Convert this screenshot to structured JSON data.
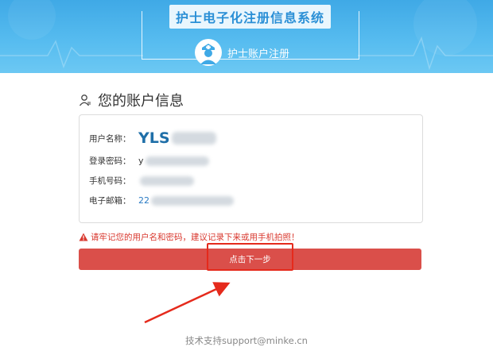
{
  "banner": {
    "title": "护士电子化注册信息系统",
    "subtitle": "护士账户注册"
  },
  "account": {
    "header": "您的账户信息",
    "username": {
      "label": "用户名称：",
      "value": "YLS"
    },
    "password": {
      "label": "登录密码：",
      "value": "y"
    },
    "phone": {
      "label": "手机号码：",
      "value": ""
    },
    "email": {
      "label": "电子邮箱：",
      "value": "22"
    }
  },
  "warning": "请牢记您的用户名和密码，建议记录下来或用手机拍照！",
  "next_button": "点击下一步",
  "footer": "技术支持support@minke.cn",
  "colors": {
    "banner": "#3fa9e6",
    "button": "#da4f4a",
    "warning": "#d9392f",
    "annotation": "#e52a1c"
  }
}
